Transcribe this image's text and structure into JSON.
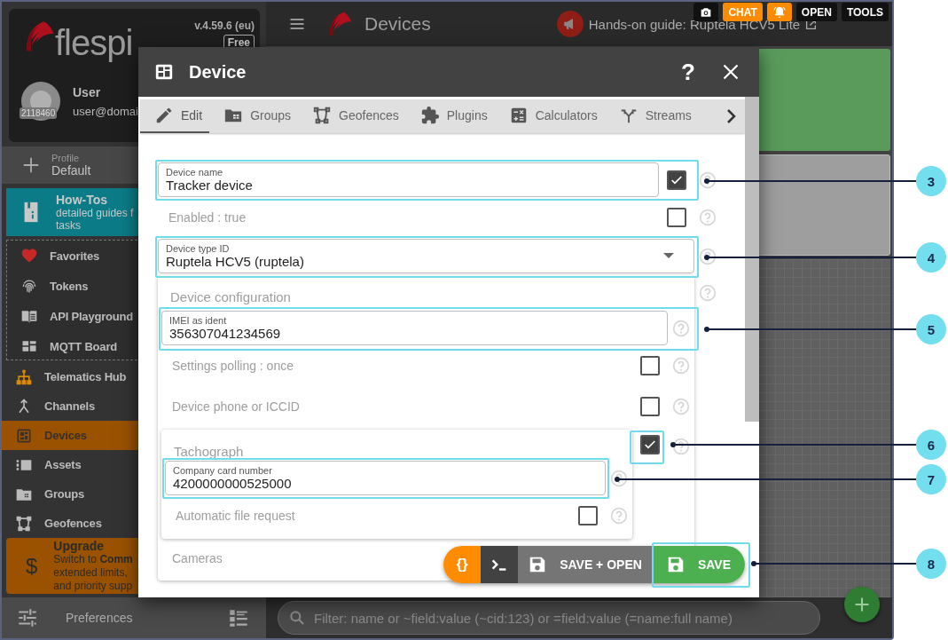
{
  "sidebar": {
    "version": "v.4.59.6 (eu)",
    "logo_text": "flespi",
    "plan_badge": "Free",
    "user": {
      "name": "User",
      "email": "user@domai",
      "account_id": "2118460"
    },
    "profile": {
      "label": "Profile",
      "value": "Default"
    },
    "howtos": {
      "title": "How-Tos",
      "lines": [
        "detailed guides f",
        "tasks"
      ]
    },
    "favorites": [
      {
        "label": "Favorites"
      },
      {
        "label": "Tokens"
      },
      {
        "label": "API Playground"
      },
      {
        "label": "MQTT Board"
      }
    ],
    "nav": [
      {
        "label": "Telematics Hub",
        "selected": false
      },
      {
        "label": "Channels",
        "selected": false
      },
      {
        "label": "Devices",
        "selected": true
      },
      {
        "label": "Assets",
        "selected": false
      },
      {
        "label": "Groups",
        "selected": false
      },
      {
        "label": "Geofences",
        "selected": false
      }
    ],
    "upgrade": {
      "symbol": "$",
      "title": "Upgrade",
      "lines": [
        "Switch to **Comm**",
        "extended limits, ",
        "and priority supp"
      ]
    },
    "footer": {
      "label": "Preferences"
    }
  },
  "header": {
    "title": "Devices",
    "guide": "Hands-on guide: Ruptela HCV5 Lite",
    "buttons": [
      {
        "kind": "icon",
        "color": "#111111"
      },
      {
        "kind": "text",
        "label": "CHAT",
        "color": "#ff8c00"
      },
      {
        "kind": "icon",
        "color": "#ff8c00"
      },
      {
        "kind": "text",
        "label": "OPEN",
        "color": "#111111"
      },
      {
        "kind": "text",
        "label": "TOOLS",
        "color": "#111111"
      }
    ]
  },
  "filter": {
    "placeholder": "Filter: name or ~field:value (~cid:123) or =field:value (=name:full name)"
  },
  "dialog": {
    "title": "Device",
    "help_label": "?",
    "tabs": [
      {
        "label": "Edit",
        "selected": true
      },
      {
        "label": "Groups",
        "selected": false
      },
      {
        "label": "Geofences",
        "selected": false
      },
      {
        "label": "Plugins",
        "selected": false
      },
      {
        "label": "Calculators",
        "selected": false
      },
      {
        "label": "Streams",
        "selected": false
      }
    ],
    "form": [
      {
        "kind": "field",
        "label": "Device name",
        "value": "Tracker device",
        "checked": true
      },
      {
        "kind": "toggle",
        "label": "Enabled : true",
        "checked": false
      },
      {
        "kind": "select",
        "label": "Device type ID",
        "value": "Ruptela HCV5 (ruptela)"
      },
      {
        "kind": "section",
        "title": "Device configuration",
        "children": [
          {
            "kind": "field",
            "label": "IMEI as ident",
            "value": "356307041234569"
          },
          {
            "kind": "toggle",
            "label": "Settings polling : once",
            "checked": false
          },
          {
            "kind": "toggle",
            "label": "Device phone or ICCID",
            "checked": false
          },
          {
            "kind": "section",
            "title": "Tachograph",
            "checked": true,
            "children": [
              {
                "kind": "field",
                "label": "Company card number",
                "value": "4200000000525000"
              },
              {
                "kind": "toggle",
                "label": "Automatic file request",
                "checked": false
              }
            ]
          },
          {
            "kind": "heading",
            "label": "Cameras"
          }
        ]
      }
    ],
    "actions": [
      {
        "kind": "json",
        "label": "{}"
      },
      {
        "kind": "console"
      },
      {
        "kind": "save_open",
        "label": "SAVE + OPEN"
      },
      {
        "kind": "save",
        "label": "SAVE"
      }
    ]
  },
  "callouts": [
    {
      "number": "3"
    },
    {
      "number": "4"
    },
    {
      "number": "5"
    },
    {
      "number": "6"
    },
    {
      "number": "7"
    },
    {
      "number": "8"
    }
  ]
}
